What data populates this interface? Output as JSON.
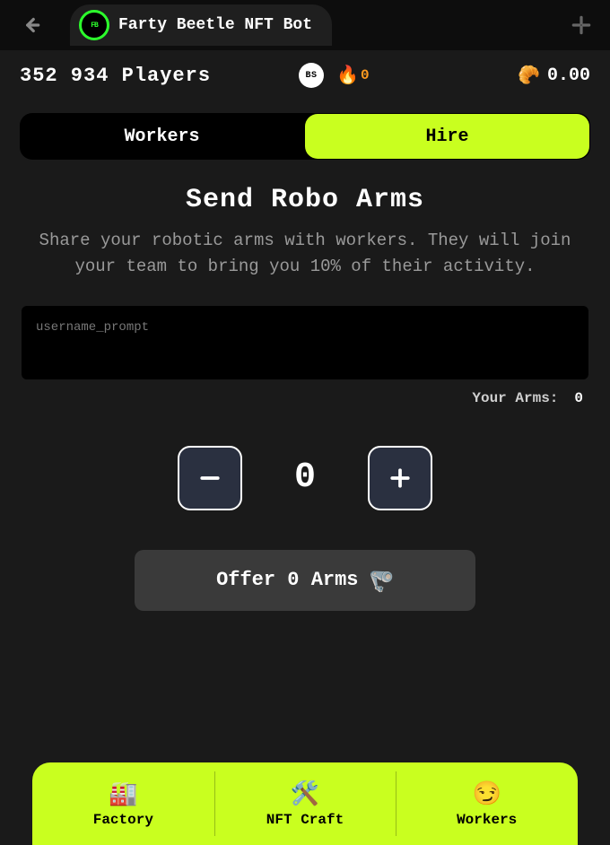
{
  "titlebar": {
    "app_title": "Farty Beetle NFT Bot"
  },
  "stats": {
    "players_text": "352 934 Players",
    "bs_badge": "BS",
    "flame_value": "0",
    "coin_value": "0.00"
  },
  "tabs": {
    "workers": "Workers",
    "hire": "Hire",
    "active": "hire"
  },
  "main": {
    "heading": "Send Robo Arms",
    "subtext": "Share your robotic arms with workers. They will join your team to bring you 10% of their activity.",
    "username_placeholder": "username_prompt",
    "arms_label": "Your Arms:",
    "arms_value": "0",
    "stepper_value": "0",
    "offer_label": "Offer 0 Arms"
  },
  "nav": {
    "factory": "Factory",
    "nft_craft": "NFT Craft",
    "workers": "Workers"
  }
}
